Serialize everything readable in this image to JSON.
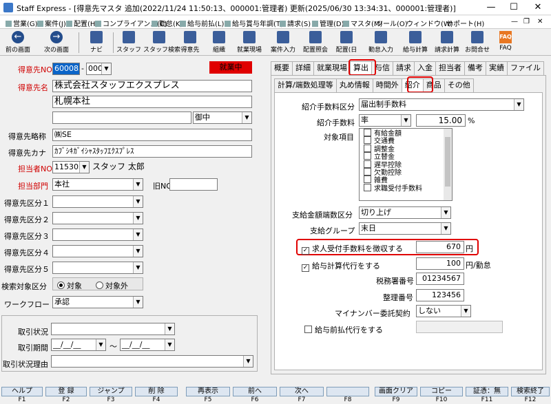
{
  "window": {
    "title": "Staff Express - [得意先マスタ  追加(2022/11/24 11:50:13、000001:管理者) 更新(2025/06/30 13:34:31、000001:管理者)]",
    "minimize": "—",
    "maximize": "☐",
    "close": "✕"
  },
  "menu": {
    "items": [
      "営業(G)",
      "案件(J)",
      "配置(H)",
      "コンプライアンス(C)",
      "勤怠(K)",
      "給与前払(L)",
      "給与賞与年調(T)",
      "請求(S)",
      "管理(D)",
      "マスタ(M)",
      "ツール(O)",
      "ウィンドウ(W)",
      "サポート(H)"
    ],
    "right_min": "—",
    "right_restore": "❐",
    "right_close": "✕"
  },
  "toolbar": {
    "prev": "前の画面",
    "next": "次の画面",
    "navi": "ナビ",
    "staff": "スタッフ",
    "staff_search": "スタッフ検索",
    "client": "得意先",
    "org": "組織",
    "site": "就業現場",
    "case_input": "案件入力",
    "placement_ref": "配置照会",
    "placement_day": "配置(日",
    "attendance": "勤怠入力",
    "payroll": "給与計算",
    "billing": "請求計算",
    "contact": "お問合せ",
    "faq": "FAQ"
  },
  "form": {
    "client_no_label": "得意先NO",
    "client_no": "600085",
    "client_sub": "000",
    "status_badge": "就業中",
    "client_name_label": "得意先名",
    "client_name": "株式会社スタッフエクスプレス",
    "branch": "札幌本社",
    "honorific": "御中",
    "abbr_label": "得意先略称",
    "abbr": "㈱SE",
    "kana_label": "得意先カナ",
    "kana": "ｶﾌﾞｼｷｶﾞｲｼｬｽﾀｯﾌｴｸｽﾌﾟﾚｽ",
    "staff_no_label": "担当者NO",
    "staff_no": "115305",
    "staff_name": "スタッフ 太郎",
    "dept_label": "担当部門",
    "dept": "本社",
    "old_no_label": "旧NO",
    "cat1": "得意先区分１",
    "cat2": "得意先区分２",
    "cat3": "得意先区分３",
    "cat4": "得意先区分４",
    "cat5": "得意先区分５",
    "search_target_label": "検索対象区分",
    "target": "対象",
    "non_target": "対象外",
    "workflow_label": "ワークフロー",
    "workflow": "承認",
    "deal_status": "取引状況",
    "deal_period": "取引期間",
    "date_blank": "__/__/__",
    "tilde": "～",
    "deal_reason": "取引状況理由"
  },
  "tabs_top": [
    "概要",
    "詳細",
    "就業現場",
    "算出",
    "与信",
    "請求",
    "入金",
    "担当者",
    "備考",
    "実績",
    "ファイル"
  ],
  "tabs_sub": [
    "計算/端数処理等",
    "丸め情報",
    "時間外",
    "紹介",
    "商品",
    "その他"
  ],
  "intro": {
    "fee_type_label": "紹介手数料区分",
    "fee_type": "届出制手数料",
    "fee_label": "紹介手数料",
    "fee_unit": "率",
    "fee_value": "15.00",
    "percent": "%",
    "target_items_label": "対象項目",
    "target_items": [
      "有給金額",
      "交通費",
      "調整金",
      "立替金",
      "遅早控除",
      "欠勤控除",
      "雑費",
      "求職受付手数料"
    ],
    "rounding_label": "支給金額端数区分",
    "rounding": "切り上げ",
    "pay_group_label": "支給グループ",
    "pay_group": "末日",
    "collect_fee_label": "求人受付手数料を徴収する",
    "collect_fee_value": "670",
    "yen": "円",
    "payroll_proxy_label": "給与計算代行をする",
    "payroll_proxy_value": "100",
    "per_attendance": "円/勤怠",
    "tax_office_label": "税務署番号",
    "tax_office": "01234567",
    "ref_no_label": "整理番号",
    "ref_no": "123456",
    "mynumber_label": "マイナンバー委託契約",
    "mynumber": "しない",
    "advance_label": "給与前払代行をする"
  },
  "fkeys": [
    {
      "label": "ヘルプ",
      "num": "F1"
    },
    {
      "label": "登 録",
      "num": "F2"
    },
    {
      "label": "ジャンプ",
      "num": "F3"
    },
    {
      "label": "削 除",
      "num": "F4"
    },
    {
      "label": "再表示",
      "num": "F5"
    },
    {
      "label": "前へ",
      "num": "F6"
    },
    {
      "label": "次へ",
      "num": "F7"
    },
    {
      "label": "",
      "num": "F8"
    },
    {
      "label": "画面クリア",
      "num": "F9"
    },
    {
      "label": "コピー",
      "num": "F10"
    },
    {
      "label": "証憑：無",
      "num": "F11"
    },
    {
      "label": "検索終了",
      "num": "F12"
    }
  ]
}
